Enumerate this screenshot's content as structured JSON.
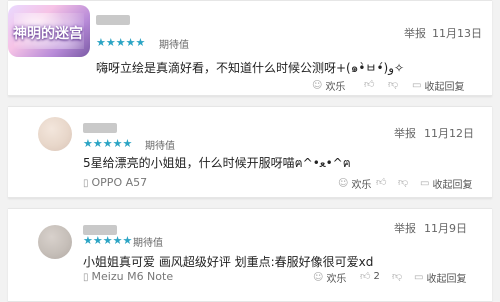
{
  "comments": [
    {
      "username": "",
      "stars": "★★★★★",
      "rating_label": "期待值",
      "report_label": "举报",
      "date": "11月13日",
      "text": "嗨呀立绘是真滴好看，不知道什么时候公测呀+(๑•̀ㅂ•́)و✧",
      "device": "",
      "actions": {
        "happy": "欢乐",
        "like": "",
        "dislike": "",
        "reply": "收起回复"
      }
    },
    {
      "username": "",
      "stars": "★★★★★",
      "rating_label": "期待值",
      "report_label": "举报",
      "date": "11月12日",
      "text": "5星给漂亮的小姐姐，什么时候开服呀喵ฅ^•ﻌ•^ฅ",
      "device": "OPPO A57",
      "actions": {
        "happy": "欢乐",
        "like": "",
        "dislike": "",
        "reply": "收起回复"
      }
    },
    {
      "username": "",
      "stars": "★★★★★",
      "rating_label": "期待值",
      "report_label": "举报",
      "date": "11月9日",
      "text": "小姐姐真可爱 画风超级好评 划重点:春服好像很可爱xd",
      "device": "Meizu M6 Note",
      "actions": {
        "happy": "欢乐",
        "like": "2",
        "dislike": "",
        "reply": "收起回复"
      }
    }
  ],
  "logo_text": "神明的迷宫",
  "icons": {
    "happy": "smile-icon",
    "like": "thumbs-up-icon",
    "dislike": "thumbs-down-icon",
    "reply": "comment-icon",
    "device": "phone-icon"
  },
  "colors": {
    "star": "#2aa4c4",
    "background": "#f2f2f2"
  }
}
